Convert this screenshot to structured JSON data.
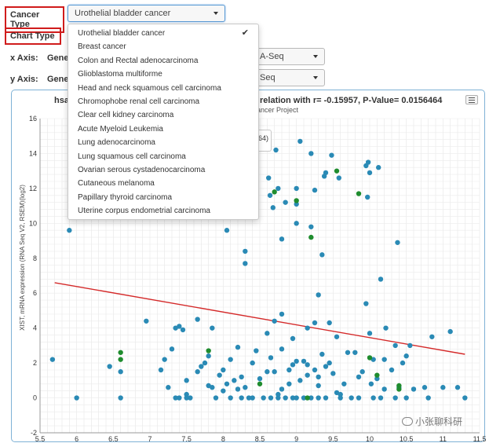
{
  "controls": {
    "cancer_type_label": "Cancer Type",
    "cancer_type_value": "Urothelial bladder cancer",
    "chart_type_label": "Chart Type",
    "x_axis_label": "x Axis:",
    "x_axis_value": "Gene",
    "x_axis_select_value": "A-Seq",
    "y_axis_label": "y Axis:",
    "y_axis_value": "Gene",
    "y_axis_select_value": "Seq"
  },
  "dropdown": {
    "options": [
      "Urothelial bladder cancer",
      "Breast cancer",
      "Colon and Rectal adenocarcinoma",
      "Glioblastoma multiforme",
      "Head and neck squamous cell carcinoma",
      "Chromophobe renal cell carcinoma",
      "Clear cell kidney carcinoma",
      "Acute Myeloid Leukemia",
      "Lung adenocarcinoma",
      "Lung squamous cell carcinoma",
      "Ovarian serous cystadenocarcinoma",
      "Cutaneous melanoma",
      "Papillary thyroid carcinoma",
      "Uterine corpus endometrial carcinoma"
    ],
    "selected_index": 0,
    "check_icon": "checkmark-icon"
  },
  "chart": {
    "title_left_fragment": "hsa",
    "title_right_fragment": "relation with r= -0.15957, P-Value= 0.0156464",
    "subtitle_fragment": "ancer Project",
    "tooltip_fragment": "64)",
    "menu_icon": "hamburger-menu-icon"
  },
  "watermark": "小张聊科研",
  "chart_data": {
    "type": "scatter",
    "title": "",
    "xlabel": "",
    "ylabel": "XIST, mRNA expression (RNA Seq V2, RSEM)(log2)",
    "xlim": [
      5.5,
      11.5
    ],
    "ylim": [
      -2,
      16
    ],
    "x_ticks": [
      "5.5",
      "6",
      "6.5",
      "7",
      "7.5",
      "8",
      "8.5",
      "9",
      "9.5",
      "10",
      "10.5",
      "11",
      "11.5"
    ],
    "y_ticks": [
      "-2",
      "0",
      "2",
      "4",
      "6",
      "8",
      "10",
      "12",
      "14",
      "16"
    ],
    "grid": true,
    "colors": {
      "blue": "#2a8ab5",
      "green": "#1f8c2e",
      "fit_line": "#d42a2a"
    },
    "fit_line": {
      "x": [
        5.7,
        11.3
      ],
      "y": [
        6.6,
        2.5
      ]
    },
    "series": [
      {
        "color_key": "blue",
        "points": [
          [
            5.67,
            2.2
          ],
          [
            5.9,
            9.6
          ],
          [
            6.0,
            0.0
          ],
          [
            6.45,
            1.8
          ],
          [
            6.6,
            0.0
          ],
          [
            6.6,
            1.5
          ],
          [
            6.95,
            4.4
          ],
          [
            7.15,
            1.6
          ],
          [
            7.2,
            2.2
          ],
          [
            7.25,
            0.6
          ],
          [
            7.3,
            2.8
          ],
          [
            7.35,
            4.0
          ],
          [
            7.35,
            0.0
          ],
          [
            7.4,
            4.1
          ],
          [
            7.4,
            0.0
          ],
          [
            7.45,
            3.9
          ],
          [
            7.5,
            0.0
          ],
          [
            7.5,
            1.0
          ],
          [
            7.55,
            0.0
          ],
          [
            7.65,
            1.5
          ],
          [
            7.65,
            4.5
          ],
          [
            7.7,
            1.8
          ],
          [
            7.75,
            2.0
          ],
          [
            7.8,
            0.7
          ],
          [
            7.8,
            2.4
          ],
          [
            7.85,
            0.6
          ],
          [
            7.85,
            4.0
          ],
          [
            7.9,
            0.0
          ],
          [
            7.95,
            1.3
          ],
          [
            8.0,
            1.6
          ],
          [
            8.0,
            0.4
          ],
          [
            8.05,
            0.8
          ],
          [
            8.1,
            2.2
          ],
          [
            8.05,
            9.6
          ],
          [
            8.1,
            0.0
          ],
          [
            8.15,
            1.0
          ],
          [
            8.2,
            0.5
          ],
          [
            8.2,
            2.9
          ],
          [
            8.25,
            0.0
          ],
          [
            8.25,
            1.2
          ],
          [
            8.3,
            0.6
          ],
          [
            8.3,
            8.4
          ],
          [
            8.3,
            7.7
          ],
          [
            8.35,
            0.0
          ],
          [
            8.4,
            2.0
          ],
          [
            8.4,
            0.0
          ],
          [
            8.45,
            2.7
          ],
          [
            8.5,
            1.1
          ],
          [
            8.55,
            0.0
          ],
          [
            8.6,
            1.5
          ],
          [
            8.6,
            3.7
          ],
          [
            8.62,
            12.6
          ],
          [
            8.64,
            11.6
          ],
          [
            8.65,
            0.0
          ],
          [
            8.65,
            2.3
          ],
          [
            8.68,
            10.9
          ],
          [
            8.7,
            4.4
          ],
          [
            8.7,
            1.5
          ],
          [
            8.72,
            14.2
          ],
          [
            8.75,
            12.0
          ],
          [
            8.75,
            0.0
          ],
          [
            8.8,
            0.5
          ],
          [
            8.8,
            4.8
          ],
          [
            8.8,
            2.8
          ],
          [
            8.8,
            9.1
          ],
          [
            8.85,
            11.2
          ],
          [
            8.85,
            0.0
          ],
          [
            8.9,
            1.6
          ],
          [
            8.9,
            0.8
          ],
          [
            8.95,
            1.9
          ],
          [
            8.95,
            3.4
          ],
          [
            8.95,
            0.0
          ],
          [
            9.0,
            12.0
          ],
          [
            9.0,
            11.1
          ],
          [
            9.0,
            10.0
          ],
          [
            9.0,
            2.1
          ],
          [
            9.0,
            0.0
          ],
          [
            9.05,
            1.0
          ],
          [
            9.05,
            14.7
          ],
          [
            9.1,
            2.1
          ],
          [
            9.1,
            0.0
          ],
          [
            9.15,
            1.9
          ],
          [
            9.15,
            1.3
          ],
          [
            9.15,
            4.0
          ],
          [
            9.2,
            9.8
          ],
          [
            9.2,
            0.0
          ],
          [
            9.25,
            1.6
          ],
          [
            9.25,
            4.3
          ],
          [
            9.25,
            11.9
          ],
          [
            9.3,
            0.7
          ],
          [
            9.3,
            5.9
          ],
          [
            9.3,
            1.2
          ],
          [
            9.3,
            0.0
          ],
          [
            9.35,
            2.5
          ],
          [
            9.35,
            8.2
          ],
          [
            9.38,
            12.7
          ],
          [
            9.4,
            12.9
          ],
          [
            9.4,
            1.8
          ],
          [
            9.4,
            0.0
          ],
          [
            9.45,
            2.0
          ],
          [
            9.45,
            4.3
          ],
          [
            9.48,
            13.9
          ],
          [
            9.5,
            1.4
          ],
          [
            9.55,
            0.3
          ],
          [
            9.58,
            12.6
          ],
          [
            9.6,
            0.0
          ],
          [
            9.65,
            0.8
          ],
          [
            9.7,
            2.6
          ],
          [
            9.75,
            0.0
          ],
          [
            9.8,
            2.6
          ],
          [
            9.85,
            1.2
          ],
          [
            9.85,
            0.0
          ],
          [
            9.9,
            1.5
          ],
          [
            9.95,
            5.4
          ],
          [
            9.95,
            13.3
          ],
          [
            9.98,
            13.5
          ],
          [
            9.97,
            11.5
          ],
          [
            10.0,
            12.9
          ],
          [
            10.0,
            3.7
          ],
          [
            10.02,
            0.8
          ],
          [
            10.05,
            2.2
          ],
          [
            10.05,
            0.0
          ],
          [
            10.1,
            1.1
          ],
          [
            10.12,
            13.2
          ],
          [
            10.15,
            6.8
          ],
          [
            10.15,
            0.0
          ],
          [
            10.2,
            0.5
          ],
          [
            10.2,
            2.2
          ],
          [
            10.22,
            4.0
          ],
          [
            10.3,
            1.6
          ],
          [
            10.35,
            0.0
          ],
          [
            10.38,
            8.9
          ],
          [
            10.4,
            0.6
          ],
          [
            10.45,
            2.0
          ],
          [
            10.5,
            0.0
          ],
          [
            10.55,
            3.0
          ],
          [
            10.6,
            0.5
          ],
          [
            10.75,
            0.6
          ],
          [
            10.8,
            0.0
          ],
          [
            10.85,
            3.5
          ],
          [
            11.0,
            0.6
          ],
          [
            11.1,
            3.8
          ],
          [
            11.2,
            0.6
          ],
          [
            11.3,
            0.0
          ],
          [
            10.35,
            3.0
          ],
          [
            10.5,
            2.4
          ],
          [
            9.55,
            3.5
          ],
          [
            9.6,
            0.2
          ],
          [
            8.75,
            0.2
          ],
          [
            7.5,
            0.2
          ],
          [
            9.2,
            14.0
          ]
        ]
      },
      {
        "color_key": "green",
        "points": [
          [
            6.6,
            2.6
          ],
          [
            6.6,
            2.2
          ],
          [
            7.8,
            2.7
          ],
          [
            8.4,
            11.0
          ],
          [
            8.5,
            0.8
          ],
          [
            8.7,
            11.8
          ],
          [
            9.0,
            11.3
          ],
          [
            9.2,
            9.2
          ],
          [
            9.55,
            13.0
          ],
          [
            9.85,
            11.7
          ],
          [
            10.0,
            2.3
          ],
          [
            10.1,
            1.3
          ],
          [
            10.4,
            0.7
          ],
          [
            10.4,
            0.5
          ],
          [
            9.15,
            0.0
          ]
        ]
      }
    ]
  }
}
